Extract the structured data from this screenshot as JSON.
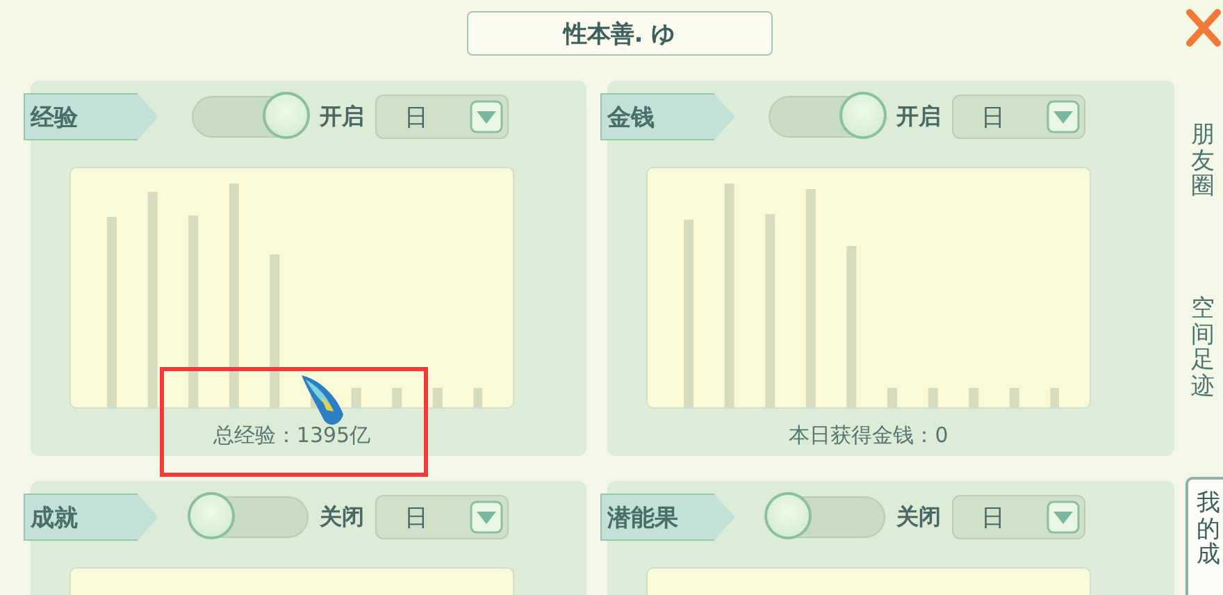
{
  "title": "性本善. ゆ",
  "cards": [
    {
      "label": "经验",
      "switch_on": true,
      "switch_text": "开启",
      "period": "日",
      "caption": "总经验：1395亿",
      "highlighted": true
    },
    {
      "label": "金钱",
      "switch_on": true,
      "switch_text": "开启",
      "period": "日",
      "caption": "本日获得金钱：0",
      "highlighted": false
    },
    {
      "label": "成就",
      "switch_on": false,
      "switch_text": "关闭",
      "period": "日",
      "highlighted": false
    },
    {
      "label": "潜能果",
      "switch_on": false,
      "switch_text": "关闭",
      "period": "日",
      "highlighted": false
    }
  ],
  "side_tabs": [
    {
      "label": "朋友圈",
      "selected": false
    },
    {
      "label": "空间足迹",
      "selected": false
    },
    {
      "label": "我的成",
      "selected": true
    }
  ]
}
